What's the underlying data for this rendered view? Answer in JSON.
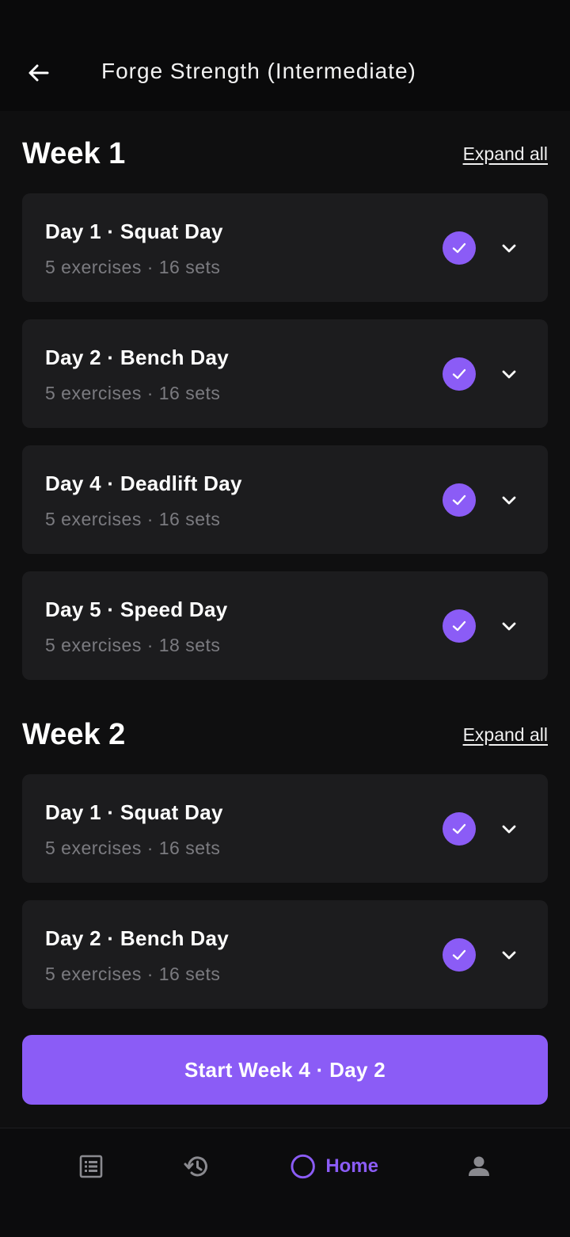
{
  "theme": {
    "accent": "#8b5cf6",
    "check_bg": "#8b5cf6",
    "muted": "#7b7b80",
    "nav_icon": "#8a8a8f"
  },
  "header": {
    "title": "Forge Strength (Intermediate)",
    "back_icon": "arrow-left-icon"
  },
  "weeks": [
    {
      "title": "Week 1",
      "expand_label": "Expand all",
      "days": [
        {
          "title": "Day 1 · Squat Day",
          "subtitle": "5 exercises · 16 sets",
          "completed": true
        },
        {
          "title": "Day 2 · Bench Day",
          "subtitle": "5 exercises · 16 sets",
          "completed": true
        },
        {
          "title": "Day 4 · Deadlift Day",
          "subtitle": "5 exercises · 16 sets",
          "completed": true
        },
        {
          "title": "Day 5 · Speed Day",
          "subtitle": "5 exercises · 18 sets",
          "completed": true
        }
      ]
    },
    {
      "title": "Week 2",
      "expand_label": "Expand all",
      "days": [
        {
          "title": "Day 1 · Squat Day",
          "subtitle": "5 exercises · 16 sets",
          "completed": true
        },
        {
          "title": "Day 2 · Bench Day",
          "subtitle": "5 exercises · 16 sets",
          "completed": true
        }
      ]
    }
  ],
  "start_button": {
    "label": "Start Week 4 · Day 2"
  },
  "bottom_nav": {
    "items": [
      {
        "icon": "list-icon",
        "label": ""
      },
      {
        "icon": "history-icon",
        "label": ""
      },
      {
        "icon": "home-circle-icon",
        "label": "Home",
        "active": true
      },
      {
        "icon": "profile-icon",
        "label": ""
      }
    ]
  }
}
